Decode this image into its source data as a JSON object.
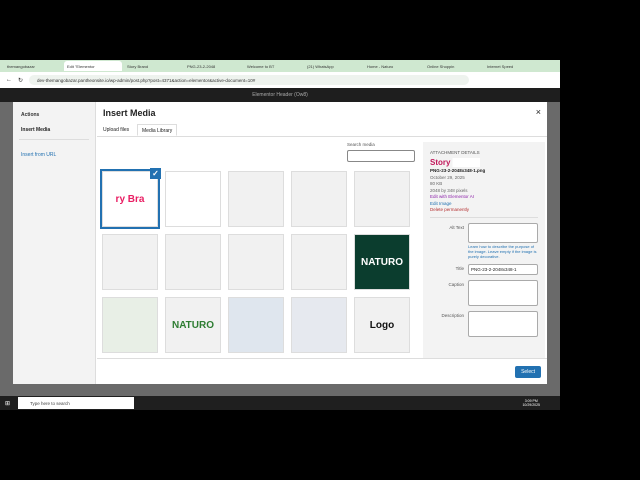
{
  "browser": {
    "tabs": [
      "themangobazar",
      "Edit \"Elementor",
      "Story Brand",
      "PNG-23-2-2048",
      "Welcome to BT",
      "(21) WhatsApp",
      "Home - Naturo",
      "Online Shoppin",
      "Internet Speed"
    ],
    "url": "dev-themangobazar.pantheonsite.io/wp-admin/post.php?post=4371&action=elementor&active-document=10#"
  },
  "elementor": {
    "title": "Elementor Header (Ow8)"
  },
  "modal": {
    "title": "Insert Media",
    "close": "×",
    "sidebar": {
      "heading": "Actions",
      "insert_media": "Insert Media",
      "insert_url": "Insert from URL"
    },
    "tabs": [
      "Upload files",
      "Media Library"
    ],
    "search_label": "Search media",
    "thumbs": [
      "ry Bra",
      "",
      "",
      "",
      "",
      "",
      "",
      "",
      "",
      "NATURO",
      "",
      "NATURO",
      "",
      "",
      "Logo"
    ],
    "details": {
      "heading": "ATTACHMENT DETAILS",
      "preview": "Story",
      "filename": "PNG-23-2-2048x348-1.png",
      "date": "October 29, 2025",
      "size": "80 KB",
      "dims": "2048 by 348 pixels",
      "edit_ai": "Edit with Elementor AI",
      "edit_image": "Edit Image",
      "delete": "Delete permanently",
      "alt_label": "Alt Text",
      "alt_help": "Learn how to describe the purpose of the image. Leave empty if the image is purely decorative.",
      "title_label": "Title",
      "title_value": "PNG-23-2-2048x348-1",
      "caption_label": "Caption",
      "description_label": "Description"
    },
    "select": "Select"
  },
  "taskbar": {
    "search": "Type here to search",
    "time": "3:09 PM",
    "date": "10/29/2025"
  }
}
